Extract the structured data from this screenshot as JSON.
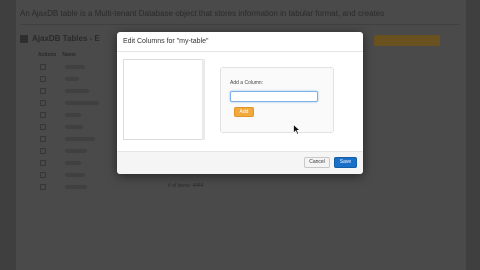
{
  "background": {
    "intro_text": "An AjaxDB table is a Multi-tenant Database object that stores information in tabular format, and creates",
    "title": "AjaxDB Tables - E",
    "header_cols": [
      "Actions",
      "Name"
    ],
    "last_row_type": "# of items: 4444"
  },
  "modal": {
    "title": "Edit Columns for \"my-table\"",
    "add_column_label": "Add a Column:",
    "add_column_value": "",
    "add_button": "Add",
    "cancel_button": "Cancel",
    "save_button": "Save"
  },
  "colors": {
    "add_button": "#f2a93b",
    "save_button": "#1a6fc9"
  }
}
